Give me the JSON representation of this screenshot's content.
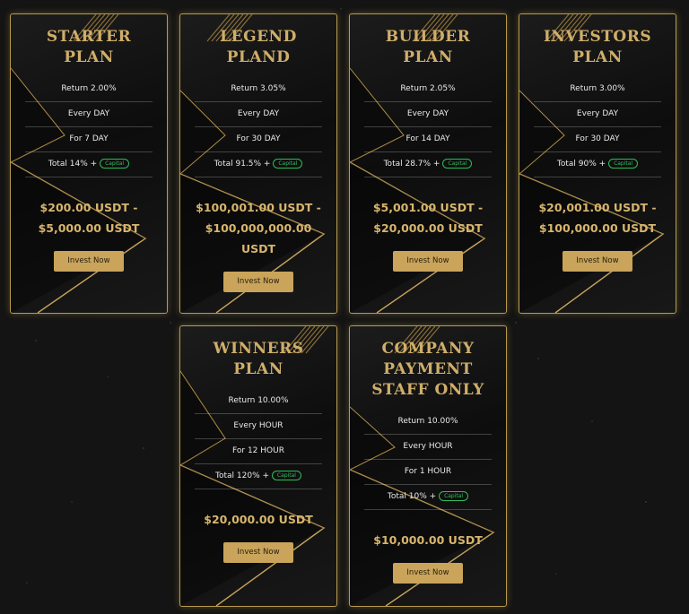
{
  "plans": [
    {
      "title": "STARTER PLAN",
      "return": "Return 2.00%",
      "frequency": "Every DAY",
      "duration": "For 7 DAY",
      "total": "Total 14% +",
      "capital": "Capital",
      "price": "$200.00 USDT - $5,000.00 USDT",
      "button": "Invest Now"
    },
    {
      "title": "LEGEND PLAND",
      "return": "Return 3.05%",
      "frequency": "Every DAY",
      "duration": "For 30 DAY",
      "total": "Total 91.5% +",
      "capital": "Capital",
      "price": "$100,001.00 USDT - $100,000,000.00 USDT",
      "button": "Invest Now"
    },
    {
      "title": "BUILDER PLAN",
      "return": "Return 2.05%",
      "frequency": "Every DAY",
      "duration": "For 14 DAY",
      "total": "Total 28.7% +",
      "capital": "Capital",
      "price": "$5,001.00 USDT - $20,000.00 USDT",
      "button": "Invest Now"
    },
    {
      "title": "INVESTORS PLAN",
      "return": "Return 3.00%",
      "frequency": "Every DAY",
      "duration": "For 30 DAY",
      "total": "Total 90% +",
      "capital": "Capital",
      "price": "$20,001.00 USDT - $100,000.00 USDT",
      "button": "Invest Now"
    },
    {
      "title": "WINNERS PLAN",
      "return": "Return 10.00%",
      "frequency": "Every HOUR",
      "duration": "For 12 HOUR",
      "total": "Total 120% +",
      "capital": "Capital",
      "price": "$20,000.00 USDT",
      "button": "Invest Now"
    },
    {
      "title": "COMPANY PAYMENT STAFF ONLY",
      "return": "Return 10.00%",
      "frequency": "Every HOUR",
      "duration": "For 1 HOUR",
      "total": "Total 10% +",
      "capital": "Capital",
      "price": "$10,000.00 USDT",
      "button": "Invest Now"
    }
  ],
  "colors": {
    "gold": "#cfae6a",
    "button": "#c9a45a",
    "capital": "#2ebd5a",
    "background": "#141414"
  }
}
